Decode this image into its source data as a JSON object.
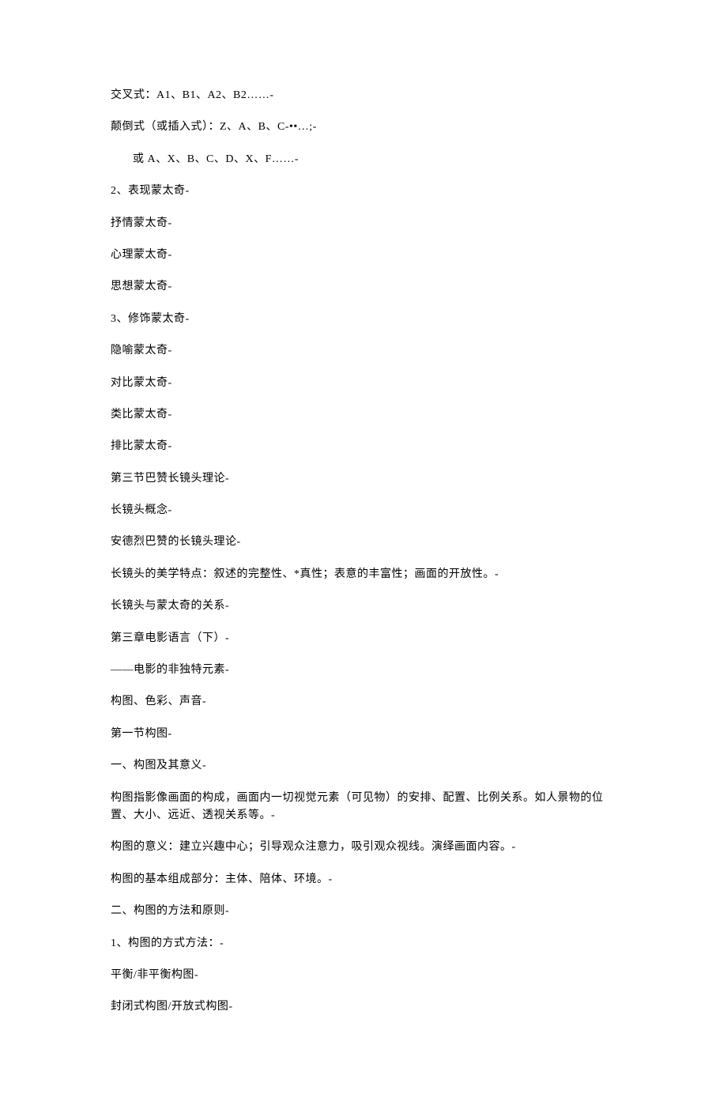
{
  "lines": [
    {
      "text": "交叉式：A1、B1、A2、B2……-",
      "indent": false
    },
    {
      "text": "颠倒式（或插入式）：Z、A、B、C-••…;-",
      "indent": false
    },
    {
      "text": "或 A、X、B、C、D、X、F……-",
      "indent": true
    },
    {
      "text": "2、表现蒙太奇-",
      "indent": false
    },
    {
      "text": "抒情蒙太奇-",
      "indent": false
    },
    {
      "text": "心理蒙太奇-",
      "indent": false
    },
    {
      "text": "思想蒙太奇-",
      "indent": false
    },
    {
      "text": "3、修饰蒙太奇-",
      "indent": false
    },
    {
      "text": "隐喻蒙太奇-",
      "indent": false
    },
    {
      "text": "对比蒙太奇-",
      "indent": false
    },
    {
      "text": "类比蒙太奇-",
      "indent": false
    },
    {
      "text": "排比蒙太奇-",
      "indent": false
    },
    {
      "text": "第三节巴赞长镜头理论-",
      "indent": false
    },
    {
      "text": "长镜头概念-",
      "indent": false
    },
    {
      "text": "安德烈巴赞的长镜头理论-",
      "indent": false
    },
    {
      "text": "长镜头的美学特点：叙述的完整性、*真性；表意的丰富性；画面的开放性。-",
      "indent": false
    },
    {
      "text": "长镜头与蒙太奇的关系-",
      "indent": false
    },
    {
      "text": "第三章电影语言（下）-",
      "indent": false
    },
    {
      "text": "——电影的非独特元素-",
      "indent": false
    },
    {
      "text": "构图、色彩、声音-",
      "indent": false
    },
    {
      "text": "第一节构图-",
      "indent": false
    },
    {
      "text": "一、构图及其意义-",
      "indent": false
    },
    {
      "text": "构图指影像画面的构成，画面内一切视觉元素（可见物）的安排、配置、比例关系。如人景物的位置、大小、远近、透视关系等。-",
      "indent": false
    },
    {
      "text": "构图的意义：建立兴趣中心；引导观众注意力，吸引观众视线。演绎画面内容。-",
      "indent": false
    },
    {
      "text": "构图的基本组成部分：主体、陪体、环境。-",
      "indent": false
    },
    {
      "text": "二、构图的方法和原则-",
      "indent": false
    },
    {
      "text": "1、构图的方式方法：-",
      "indent": false
    },
    {
      "text": "平衡/非平衡构图-",
      "indent": false
    },
    {
      "text": "封闭式构图/开放式构图-",
      "indent": false
    }
  ]
}
